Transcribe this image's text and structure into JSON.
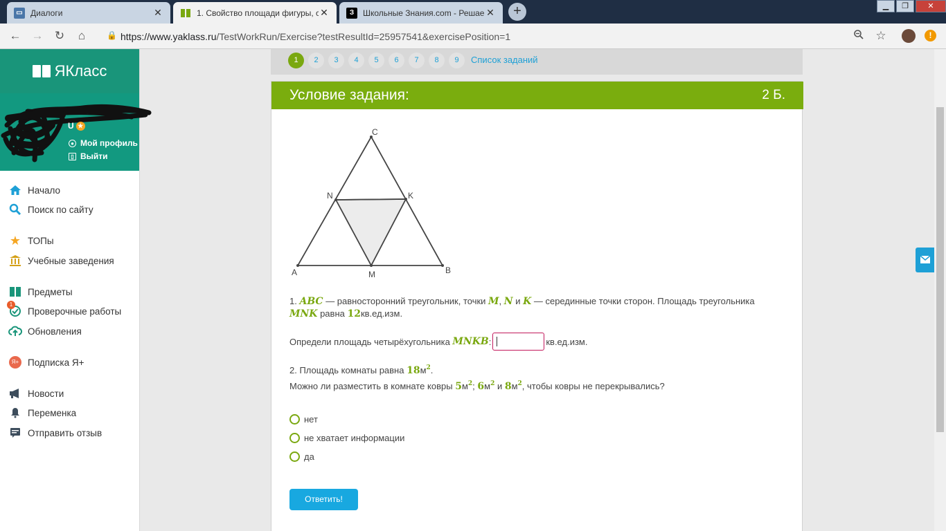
{
  "browser": {
    "tabs": [
      {
        "title": "Диалоги",
        "active": false,
        "icon": "chat-icon",
        "color": "#4a76a8"
      },
      {
        "title": "1. Свойство площади фигуры, с",
        "active": true,
        "icon": "yaklass-icon",
        "color": "#7aa810"
      },
      {
        "title": "Школьные Знания.com - Решае",
        "active": false,
        "icon": "znania-icon",
        "color": "#000000"
      }
    ],
    "url_host": "https://www.yaklass.ru",
    "url_path": "/TestWorkRun/Exercise?testResultId=25957541&exercisePosition=1"
  },
  "sidebar": {
    "logo_text": "ЯКласс",
    "user_initial": "U",
    "profile_link": "Мой профиль",
    "logout_link": "Выйти",
    "badge_count": "1",
    "items": [
      {
        "label": "Начало",
        "icon": "home-icon"
      },
      {
        "label": "Поиск по сайту",
        "icon": "search-icon"
      },
      {
        "label": "ТОПы",
        "icon": "star-icon"
      },
      {
        "label": "Учебные заведения",
        "icon": "institution-icon"
      },
      {
        "label": "Предметы",
        "icon": "books-icon"
      },
      {
        "label": "Проверочные работы",
        "icon": "tests-icon"
      },
      {
        "label": "Обновления",
        "icon": "cloud-icon"
      },
      {
        "label": "Подписка Я+",
        "icon": "subscription-icon"
      },
      {
        "label": "Новости",
        "icon": "megaphone-icon"
      },
      {
        "label": "Переменка",
        "icon": "bell-icon"
      },
      {
        "label": "Отправить отзыв",
        "icon": "feedback-icon"
      }
    ]
  },
  "pager": {
    "pages": [
      "1",
      "2",
      "3",
      "4",
      "5",
      "6",
      "7",
      "8",
      "9"
    ],
    "current": "1",
    "task_list": "Список заданий"
  },
  "task": {
    "header": "Условие задания:",
    "score": "2 Б.",
    "figure_labels": {
      "A": "A",
      "B": "B",
      "C": "C",
      "N": "N",
      "K": "K",
      "M": "M"
    },
    "q1": {
      "num": "1.",
      "abc": "ABC",
      "t1": " — равносторонний треугольник, точки ",
      "m": "M",
      "n": "N",
      "and": " и ",
      "k": "K",
      "t2": " — серединные точки сторон. Площадь треугольника",
      "mnk": "MNK",
      "t3": " равна ",
      "val": "12",
      "unit": "кв.ед.изм.",
      "ask": "Определи площадь четырёхугольника ",
      "mnkb": "MNKB",
      "colon": ":",
      "unit2": "кв.ед.изм."
    },
    "q2": {
      "num": "2.",
      "t1": " Площадь комнаты равна ",
      "area": "18",
      "unit": "м",
      "sq": "2",
      "dot": ".",
      "t2": "Можно ли разместить в комнате ковры ",
      "c1": "5",
      "c2": "6",
      "c3": "8",
      "sep": "; ",
      "and": " и ",
      "t3": ", чтобы ковры не перекрывались?"
    },
    "options": [
      "нет",
      "не хватает информации",
      "да"
    ],
    "submit": "Ответить!"
  }
}
